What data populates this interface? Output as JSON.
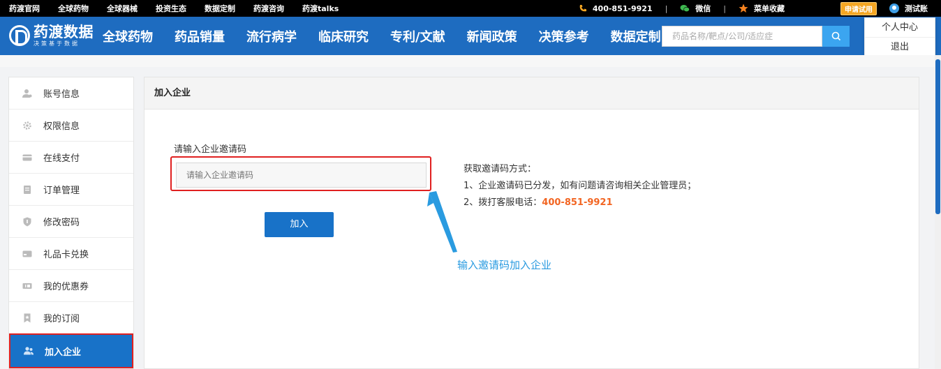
{
  "topbar": {
    "links": [
      "药渡官网",
      "全球药物",
      "全球器械",
      "投资生态",
      "数据定制",
      "药渡咨询",
      "药渡talks"
    ],
    "phone": "400-851-9921",
    "wechat": "微信",
    "favorite": "菜单收藏",
    "trial": "申请试用",
    "user": "测试账",
    "separator": "|"
  },
  "nav": {
    "logo_main": "药渡数据",
    "logo_sub": "决策基于数据",
    "items": [
      "全球药物",
      "药品销量",
      "流行病学",
      "临床研究",
      "专利/文献",
      "新闻政策",
      "决策参考",
      "数据定制"
    ],
    "search_placeholder": "药品名称/靶点/公司/适应症"
  },
  "dropdown": {
    "items": [
      "个人中心",
      "退出"
    ]
  },
  "sidebar": {
    "items": [
      {
        "label": "账号信息",
        "icon": "user-icon"
      },
      {
        "label": "权限信息",
        "icon": "gear-icon"
      },
      {
        "label": "在线支付",
        "icon": "card-icon"
      },
      {
        "label": "订单管理",
        "icon": "order-icon"
      },
      {
        "label": "修改密码",
        "icon": "shield-icon"
      },
      {
        "label": "礼品卡兑换",
        "icon": "giftcard-icon"
      },
      {
        "label": "我的优惠券",
        "icon": "coupon-icon"
      },
      {
        "label": "我的订阅",
        "icon": "bookmark-icon"
      },
      {
        "label": "加入企业",
        "icon": "group-icon",
        "active": true
      }
    ]
  },
  "main": {
    "title": "加入企业",
    "field_label": "请输入企业邀请码",
    "input_placeholder": "请输入企业邀请码",
    "join_button": "加入",
    "info_title": "获取邀请码方式：",
    "info_line1": "1、企业邀请码已分发，如有问题请咨询相关企业管理员；",
    "info_line2_prefix": "2、拨打客服电话：",
    "info_phone": "400-851-9921",
    "annotation": "输入邀请码加入企业"
  },
  "colors": {
    "nav_blue": "#1e6cc0",
    "accent_blue": "#1872c8",
    "highlight_red": "#e02020",
    "phone_orange": "#f26522",
    "annotation_blue": "#2a9be0"
  }
}
